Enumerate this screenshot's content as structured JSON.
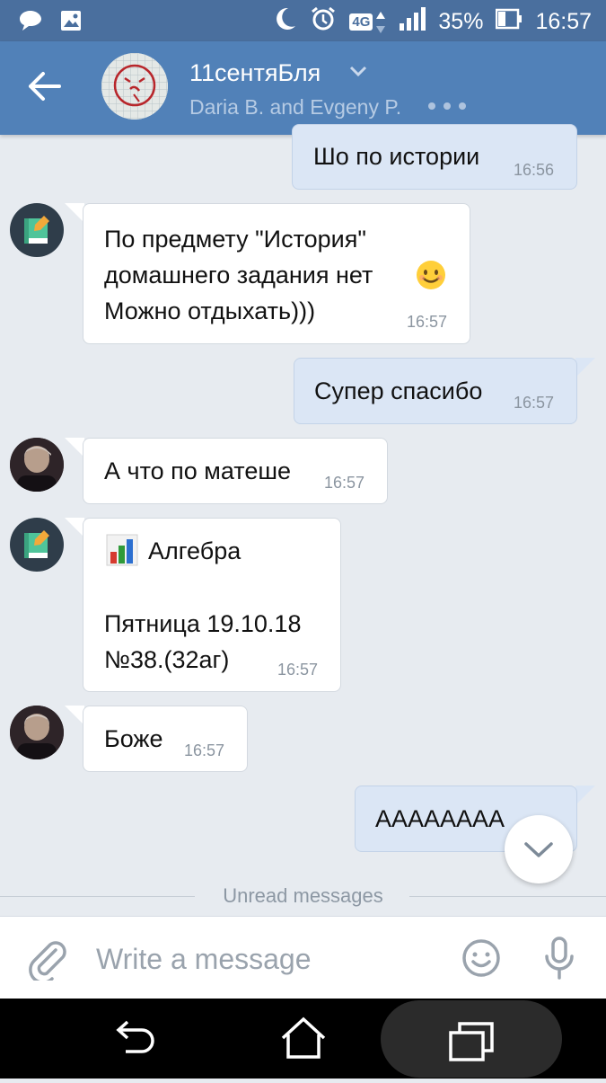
{
  "status_bar": {
    "network": "4G",
    "battery": "35%",
    "time": "16:57",
    "icons": [
      "chat-bubble-icon",
      "image-icon",
      "moon-icon",
      "alarm-icon",
      "network-4g-icon",
      "signal-icon",
      "battery-icon"
    ]
  },
  "header": {
    "title": "11сентяБля",
    "subtitle": "Daria B. and Evgeny P.",
    "background": "#5181b8"
  },
  "messages": [
    {
      "id": "m1",
      "direction": "out",
      "lines": [
        "Шо по истории"
      ],
      "time": "16:56"
    },
    {
      "id": "m2",
      "direction": "in",
      "sender_avatar": "bot",
      "lines": [
        "По предмету \"История\"",
        "домашнего задания нет",
        "Можно отдыхать)))"
      ],
      "emoji": "smiling-face-emoji",
      "time": "16:57"
    },
    {
      "id": "m3",
      "direction": "out",
      "lines": [
        "Супер спасибо"
      ],
      "time": "16:57"
    },
    {
      "id": "m4",
      "direction": "in",
      "sender_avatar": "user",
      "lines": [
        "А что по матеше"
      ],
      "time": "16:57"
    },
    {
      "id": "m5",
      "direction": "in",
      "sender_avatar": "bot",
      "lines": [
        "Алгебра",
        "Пятница 19.10.18",
        "№38.(32аг)"
      ],
      "icon": "bar-chart-icon",
      "time": "16:57"
    },
    {
      "id": "m6",
      "direction": "in",
      "sender_avatar": "user",
      "lines": [
        "Боже"
      ],
      "time": "16:57"
    },
    {
      "id": "m7",
      "direction": "out",
      "lines": [
        "АААААААА"
      ],
      "time": ""
    }
  ],
  "unread_label": "Unread messages",
  "composer": {
    "placeholder": "Write a message",
    "value": ""
  },
  "colors": {
    "outgoing_bubble": "#dbe6f5",
    "incoming_bubble": "#ffffff",
    "background": "#e7ebf0"
  }
}
